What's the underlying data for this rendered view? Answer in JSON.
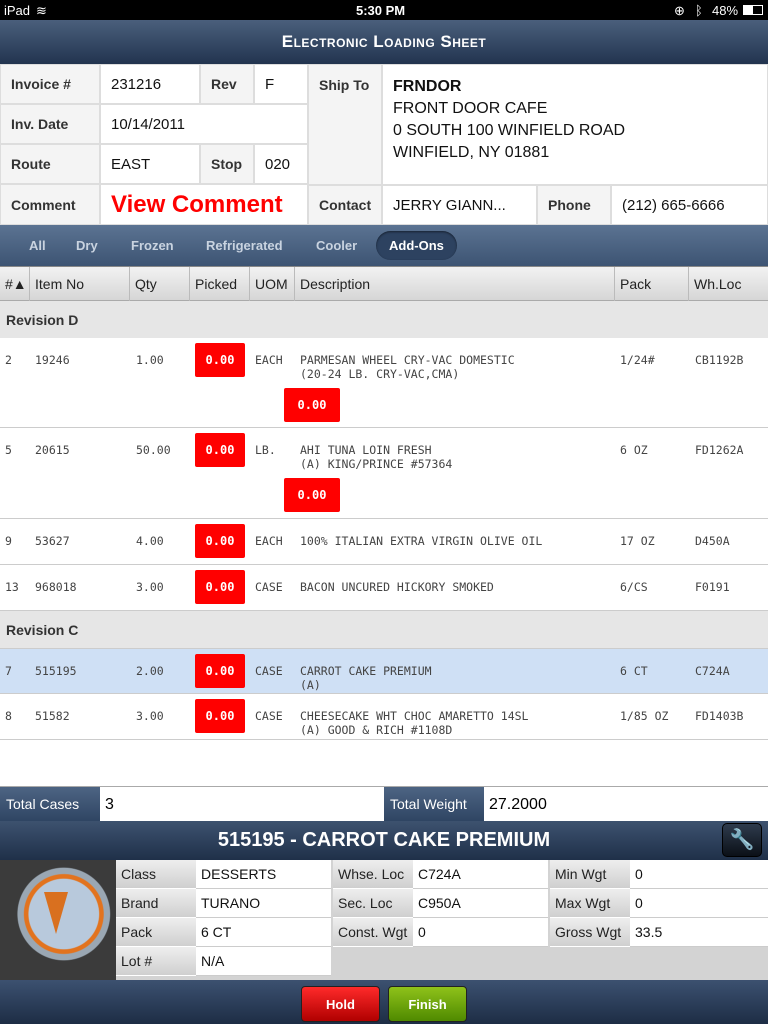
{
  "status": {
    "device": "iPad",
    "time": "5:30 PM",
    "battery": "48%"
  },
  "title": "Electronic Loading Sheet",
  "header": {
    "invoice_label": "Invoice #",
    "invoice": "231216",
    "rev_label": "Rev",
    "rev": "F",
    "date_label": "Inv. Date",
    "date": "10/14/2011",
    "route_label": "Route",
    "route": "EAST",
    "stop_label": "Stop",
    "stop": "020",
    "comment_label": "Comment",
    "comment": "View Comment",
    "shipto_label": "Ship To",
    "ship_code": "FRNDOR",
    "ship_name": "FRONT DOOR CAFE",
    "ship_addr": "0 SOUTH 100 WINFIELD ROAD",
    "ship_city": "WINFIELD, NY 01881",
    "contact_label": "Contact",
    "contact": "JERRY GIANN...",
    "phone_label": "Phone",
    "phone": "(212) 665-6666"
  },
  "tabs": [
    "All",
    "Dry",
    "Frozen",
    "Refrigerated",
    "Cooler",
    "Add-Ons"
  ],
  "active_tab": "Add-Ons",
  "columns": [
    "#▲",
    "Item No",
    "Qty",
    "Picked",
    "UOM",
    "Description",
    "Pack",
    "Wh.Loc"
  ],
  "groups": [
    "Revision D",
    "Revision C"
  ],
  "rows": [
    {
      "num": "2",
      "item": "19246",
      "qty": "1.00",
      "picked": "0.00",
      "uom": "EACH",
      "desc": "PARMESAN WHEEL CRY-VAC DOMESTIC",
      "desc2": "(20-24 LB. CRY-VAC,CMA)",
      "pack": "1/24#",
      "loc": "CB1192B",
      "picked2": "0.00"
    },
    {
      "num": "5",
      "item": "20615",
      "qty": "50.00",
      "picked": "0.00",
      "uom": "LB.",
      "desc": "AHI TUNA LOIN FRESH",
      "desc2": "(A) KING/PRINCE #57364",
      "pack": "6 OZ",
      "loc": "FD1262A",
      "picked2": "0.00"
    },
    {
      "num": "9",
      "item": "53627",
      "qty": "4.00",
      "picked": "0.00",
      "uom": "EACH",
      "desc": "100% ITALIAN EXTRA VIRGIN OLIVE OIL",
      "desc2": "",
      "pack": "17 OZ",
      "loc": "D450A"
    },
    {
      "num": "13",
      "item": "968018",
      "qty": "3.00",
      "picked": "0.00",
      "uom": "CASE",
      "desc": "BACON UNCURED HICKORY SMOKED",
      "desc2": "",
      "pack": "6/CS",
      "loc": "F0191"
    },
    {
      "num": "7",
      "item": "515195",
      "qty": "2.00",
      "picked": "0.00",
      "uom": "CASE",
      "desc": "CARROT CAKE PREMIUM",
      "desc2": "(A)",
      "pack": "6 CT",
      "loc": "C724A"
    },
    {
      "num": "8",
      "item": "51582",
      "qty": "3.00",
      "picked": "0.00",
      "uom": "CASE",
      "desc": "CHEESECAKE WHT CHOC AMARETTO 14SL",
      "desc2": "(A) GOOD & RICH #1108D",
      "pack": "1/85 OZ",
      "loc": "FD1403B"
    }
  ],
  "totals": {
    "cases_label": "Total Cases",
    "cases": "3",
    "weight_label": "Total Weight",
    "weight": "27.2000"
  },
  "detail": {
    "title": "515195 - CARROT CAKE PREMIUM",
    "fields": [
      {
        "label": "Class",
        "value": "DESSERTS"
      },
      {
        "label": "Brand",
        "value": "TURANO"
      },
      {
        "label": "Pack",
        "value": "6 CT"
      },
      {
        "label": "Lot #",
        "value": "N/A"
      },
      {
        "label": "Whse. Loc",
        "value": "C724A"
      },
      {
        "label": "Sec. Loc",
        "value": "C950A"
      },
      {
        "label": "Const. Wgt",
        "value": "0"
      },
      {
        "label": "Min Wgt",
        "value": "0"
      },
      {
        "label": "Max Wgt",
        "value": "0"
      },
      {
        "label": "Gross Wgt",
        "value": "33.5"
      }
    ]
  },
  "footer": {
    "hold": "Hold",
    "finish": "Finish"
  },
  "colors": {
    "picked_bg": "#ff0000",
    "selected_row": "#cfe0f5",
    "hold": "#d00000",
    "finish": "#6aa000"
  }
}
